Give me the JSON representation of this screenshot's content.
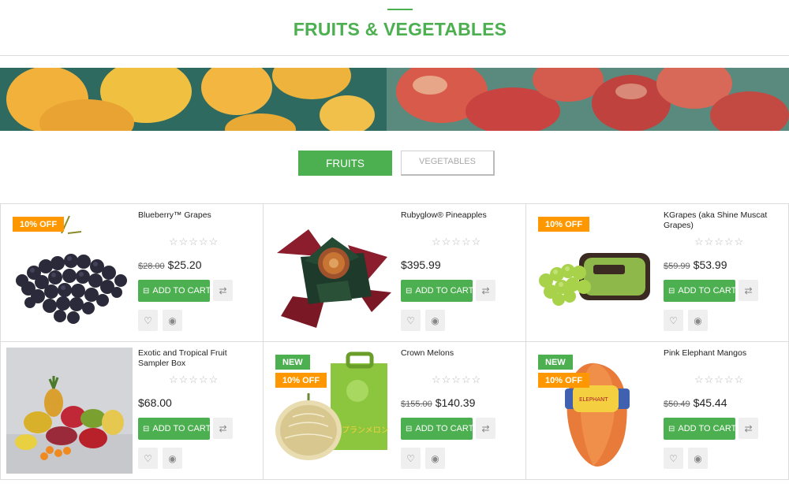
{
  "page": {
    "title": "FRUITS & VEGETABLES"
  },
  "tabs": [
    {
      "label": "FRUITS",
      "active": true
    },
    {
      "label": "VEGETABLES",
      "active": false
    }
  ],
  "colors": {
    "accent": "#4caf50",
    "sale_badge": "#ff9800",
    "new_badge": "#4caf50"
  },
  "products": [
    {
      "name": "Blueberry™ Grapes",
      "old_price": "$28.00",
      "price": "$25.20",
      "badges": [
        "10% OFF"
      ],
      "rating": "☆☆☆☆☆",
      "cart_label": "ADD TO CART"
    },
    {
      "name": "Rubyglow® Pineapples",
      "old_price": "",
      "price": "$395.99",
      "badges": [],
      "rating": "☆☆☆☆☆",
      "cart_label": "ADD TO CART"
    },
    {
      "name": "KGrapes (aka Shine Muscat Grapes)",
      "old_price": "$59.99",
      "price": "$53.99",
      "badges": [
        "10% OFF"
      ],
      "rating": "☆☆☆☆☆",
      "cart_label": "ADD TO CART"
    },
    {
      "name": "Exotic and Tropical Fruit Sampler Box",
      "old_price": "",
      "price": "$68.00",
      "badges": [],
      "rating": "☆☆☆☆☆",
      "cart_label": "ADD TO CART"
    },
    {
      "name": "Crown Melons",
      "old_price": "$155.00",
      "price": "$140.39",
      "badges": [
        "NEW",
        "10% OFF"
      ],
      "rating": "☆☆☆☆☆",
      "cart_label": "ADD TO CART"
    },
    {
      "name": "Pink Elephant Mangos",
      "old_price": "$50.49",
      "price": "$45.44",
      "badges": [
        "NEW",
        "10% OFF"
      ],
      "rating": "☆☆☆☆☆",
      "cart_label": "ADD TO CART"
    }
  ],
  "icons": {
    "cart": "cart-icon",
    "compare": "compare-icon",
    "wishlist": "heart-icon",
    "quickview": "eye-icon"
  },
  "melon_box_text": "プランメロン"
}
